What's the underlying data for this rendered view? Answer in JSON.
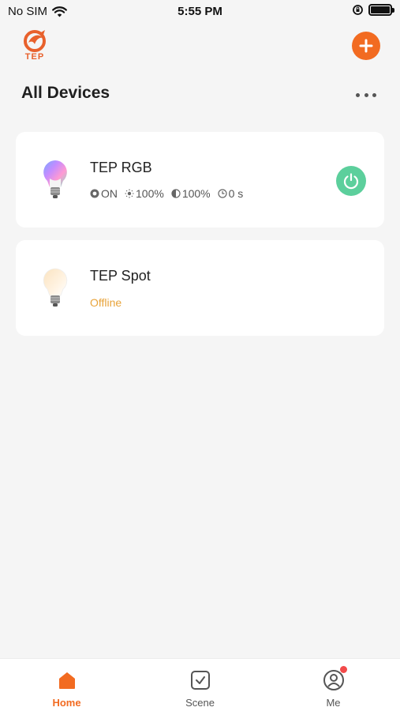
{
  "status_bar": {
    "carrier": "No SIM",
    "time": "5:55 PM"
  },
  "header": {
    "logo_text": "TEP",
    "title": "All Devices"
  },
  "devices": [
    {
      "name": "TEP RGB",
      "power": "ON",
      "brightness": "100%",
      "temperature": "100%",
      "timer": "0 s",
      "bulb_color": "rgb"
    },
    {
      "name": "TEP Spot",
      "status": "Offline",
      "bulb_color": "warm"
    }
  ],
  "tabs": [
    {
      "label": "Home",
      "icon": "home-icon",
      "active": true
    },
    {
      "label": "Scene",
      "icon": "scene-icon",
      "active": false
    },
    {
      "label": "Me",
      "icon": "profile-icon",
      "active": false
    }
  ],
  "colors": {
    "accent": "#f26b21",
    "power_on": "#5ccf9c",
    "offline": "#e8a33a",
    "notification_dot": "#f24a4a"
  }
}
